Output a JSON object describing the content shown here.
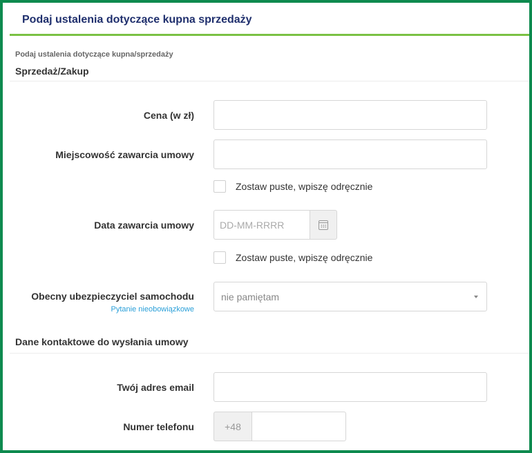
{
  "header": {
    "title": "Podaj ustalenia dotyczące kupna sprzedaży"
  },
  "breadcrumb": "Podaj ustalenia dotyczące kupna/sprzedaży",
  "section_sale": {
    "title": "Sprzedaż/Zakup"
  },
  "fields": {
    "price": {
      "label": "Cena (w zł)",
      "value": ""
    },
    "place": {
      "label": "Miejscowość zawarcia umowy",
      "value": ""
    },
    "place_blank": {
      "label": "Zostaw puste, wpiszę odręcznie",
      "checked": false
    },
    "date": {
      "label": "Data zawarcia umowy",
      "placeholder": "DD-MM-RRRR",
      "value": ""
    },
    "date_blank": {
      "label": "Zostaw puste, wpiszę odręcznie",
      "checked": false
    },
    "insurer": {
      "label": "Obecny ubezpieczyciel samochodu",
      "hint": "Pytanie nieobowiązkowe",
      "selected": "nie pamiętam"
    }
  },
  "section_contact": {
    "title": "Dane kontaktowe do wysłania umowy"
  },
  "contact": {
    "email": {
      "label": "Twój adres email",
      "value": ""
    },
    "phone": {
      "label": "Numer telefonu",
      "prefix": "+48",
      "value": ""
    }
  },
  "icons": {
    "calendar": "calendar-icon",
    "dropdown": "chevron-down-icon"
  },
  "colors": {
    "frame": "#0e8a4f",
    "header_underline": "#7ac143",
    "title": "#1f2f6d",
    "hint": "#2a9fd8"
  }
}
